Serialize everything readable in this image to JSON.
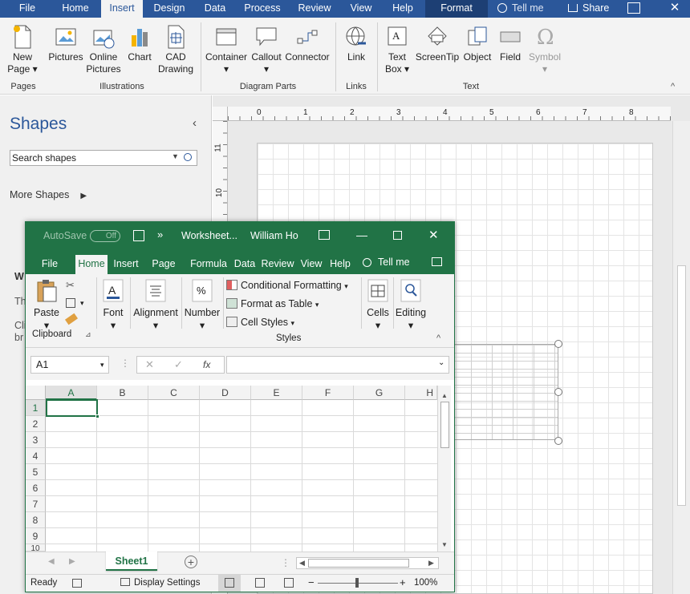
{
  "visio": {
    "tabs": [
      {
        "label": "File"
      },
      {
        "label": "Home"
      },
      {
        "label": "Insert"
      },
      {
        "label": "Design"
      },
      {
        "label": "Data"
      },
      {
        "label": "Process"
      },
      {
        "label": "Review"
      },
      {
        "label": "View"
      },
      {
        "label": "Help"
      },
      {
        "label": "Format"
      }
    ],
    "tell_me": "Tell me",
    "share": "Share",
    "ribbon": {
      "new_page": "New",
      "new_page_2": "Page",
      "pictures": "Pictures",
      "online_pictures": "Online",
      "online_pictures_2": "Pictures",
      "chart": "Chart",
      "cad": "CAD",
      "cad_2": "Drawing",
      "container": "Container",
      "callout": "Callout",
      "connector": "Connector",
      "link": "Link",
      "text_box": "Text",
      "text_box_2": "Box",
      "screentip": "ScreenTip",
      "object": "Object",
      "field": "Field",
      "symbol": "Symbol",
      "groups": {
        "pages": "Pages",
        "illustrations": "Illustrations",
        "diagram_parts": "Diagram Parts",
        "links": "Links",
        "text": "Text"
      }
    },
    "shapes_pane": {
      "title": "Shapes",
      "search_placeholder": "Search shapes",
      "more_shapes": "More Shapes",
      "hidden_heading": "W",
      "hidden_line1": "Th",
      "hidden_line2": "Cli",
      "hidden_line3": "br"
    },
    "ruler_h": [
      "0",
      "1",
      "2",
      "3",
      "4",
      "5",
      "6",
      "7",
      "8"
    ],
    "ruler_v": [
      "11",
      "10"
    ]
  },
  "excel": {
    "autosave": "AutoSave",
    "autosave_state": "Off",
    "title": "Worksheet...",
    "user": "William Ho",
    "tabs": [
      {
        "label": "File"
      },
      {
        "label": "Home"
      },
      {
        "label": "Insert"
      },
      {
        "label": "Page Lay"
      },
      {
        "label": "Formula"
      },
      {
        "label": "Data"
      },
      {
        "label": "Review"
      },
      {
        "label": "View"
      },
      {
        "label": "Help"
      }
    ],
    "tell_me": "Tell me",
    "ribbon": {
      "paste": "Paste",
      "clipboard": "Clipboard",
      "font": "Font",
      "alignment": "Alignment",
      "number": "Number",
      "conditional_formatting": "Conditional Formatting",
      "format_as_table": "Format as Table",
      "cell_styles": "Cell Styles",
      "styles": "Styles",
      "cells": "Cells",
      "editing": "Editing"
    },
    "name_box": "A1",
    "fx": "fx",
    "columns": [
      "A",
      "B",
      "C",
      "D",
      "E",
      "F",
      "G",
      "H"
    ],
    "rows": [
      "1",
      "2",
      "3",
      "4",
      "5",
      "6",
      "7",
      "8",
      "9",
      "10"
    ],
    "sheet": "Sheet1",
    "status": {
      "ready": "Ready",
      "display_settings": "Display Settings",
      "zoom": "100%"
    }
  }
}
